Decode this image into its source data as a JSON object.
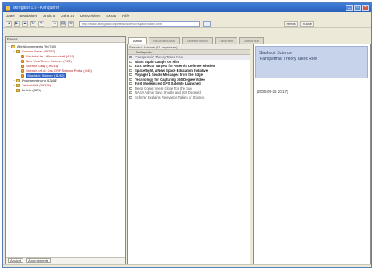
{
  "window": {
    "title": "akregator 1.0 - Konqueror",
    "buttons": [
      "_",
      "□",
      "×"
    ]
  },
  "menubar": [
    "Datei",
    "Bearbeiten",
    "Ansicht",
    "Gehe zu",
    "Lesezeichen",
    "Extras",
    "Hilfe"
  ],
  "toolbar": {
    "url": "http://www.akregator.org/feeds/science/space/index.html",
    "right_labels": [
      "Feeds",
      "Suche"
    ]
  },
  "left_panel": {
    "header": "Feeds",
    "tree": [
      {
        "label": "Alle Abonnements (94/780)",
        "level": 0,
        "type": "folder",
        "color": "normal"
      },
      {
        "label": "Science News (45/367)",
        "level": 1,
        "type": "folder",
        "color": "red"
      },
      {
        "label": "Slashdot.de - Wissenschaft (4/19)",
        "level": 2,
        "type": "feed",
        "color": "red"
      },
      {
        "label": "New York Times: Science (7/25)",
        "level": 2,
        "type": "feed",
        "color": "red"
      },
      {
        "label": "Science Daily (19/216)",
        "level": 2,
        "type": "feed",
        "color": "red"
      },
      {
        "label": "Science.orf.at: Das ORF Science Portal (4/45)",
        "level": 2,
        "type": "feed",
        "color": "red"
      },
      {
        "label": "Slashdot: Science (11/62)",
        "level": 2,
        "type": "feed",
        "color": "selected"
      },
      {
        "label": "Programmierung (13/48)",
        "level": 1,
        "type": "folder",
        "color": "normal"
      },
      {
        "label": "Tabtor Welt (29/336)",
        "level": 1,
        "type": "folder",
        "color": "red"
      },
      {
        "label": "Beliebt (8/29)",
        "level": 1,
        "type": "folder",
        "color": "normal"
      }
    ],
    "footer_buttons": [
      "Ansicht",
      "Abonnements"
    ]
  },
  "tabs": [
    {
      "label": "Artikel",
      "active": true
    },
    {
      "label": "Neueste Artikel",
      "active": false
    },
    {
      "label": "Beliebte Artikel",
      "active": false
    },
    {
      "label": "Favoriten",
      "active": false
    },
    {
      "label": "Alle Artikel",
      "active": false
    }
  ],
  "article_list": {
    "header": "Slashdot: Science (11 ungelesen)",
    "column": "Schlagzeile",
    "rows": [
      {
        "title": "'Panspermia' Theory Takes Root",
        "bold": false,
        "sel": true
      },
      {
        "title": "Giant Squid Caught on Film",
        "bold": true,
        "sel": false
      },
      {
        "title": "ESA Selects Targets for Asteroid Defense Mission",
        "bold": true,
        "sel": false
      },
      {
        "title": "Spaceflight, a New Space Education Initiative",
        "bold": true,
        "sel": false
      },
      {
        "title": "Voyager 1 Sends Messages from the Edge",
        "bold": true,
        "sel": false
      },
      {
        "title": "Technology for Capturing 360 Degree Video",
        "bold": true,
        "sel": false
      },
      {
        "title": "First Modernized GPS Satellite Launched",
        "bold": true,
        "sel": false
      },
      {
        "title": "Deep Comet Veers Close Top the Sun",
        "bold": false,
        "sel": false
      },
      {
        "title": "NASA Admin Says Shuttle and ISS Doomed",
        "bold": false,
        "sel": false
      },
      {
        "title": "Schirrer Explains Relevance Tables of Science",
        "bold": false,
        "sel": false
      }
    ]
  },
  "article_view": {
    "feed": "Slashdot: Science",
    "headline": "'Panspermia' Theory Takes Root",
    "date": "(2005-09-26 20:17)"
  }
}
